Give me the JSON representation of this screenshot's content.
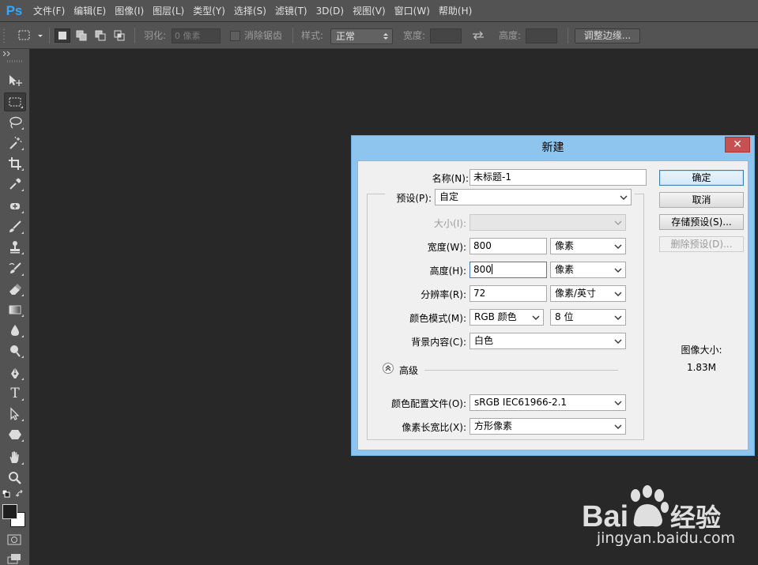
{
  "app": {
    "logo": "Ps"
  },
  "menu": [
    "文件(F)",
    "编辑(E)",
    "图像(I)",
    "图层(L)",
    "类型(Y)",
    "选择(S)",
    "滤镜(T)",
    "3D(D)",
    "视图(V)",
    "窗口(W)",
    "帮助(H)"
  ],
  "options": {
    "feather_label": "羽化:",
    "feather_value": "0 像素",
    "antialias_label": "消除锯齿",
    "style_label": "样式:",
    "style_value": "正常",
    "width_label": "宽度:",
    "height_label": "高度:",
    "refine_button": "调整边缘..."
  },
  "tools": [
    "move-tool-icon",
    "marquee-tool-icon",
    "lasso-tool-icon",
    "magic-wand-tool-icon",
    "crop-tool-icon",
    "eyedropper-tool-icon",
    "healing-brush-tool-icon",
    "brush-tool-icon",
    "clone-stamp-tool-icon",
    "history-brush-tool-icon",
    "eraser-tool-icon",
    "gradient-tool-icon",
    "blur-tool-icon",
    "dodge-tool-icon",
    "pen-tool-icon",
    "type-tool-icon",
    "path-selection-tool-icon",
    "shape-tool-icon",
    "hand-tool-icon",
    "zoom-tool-icon"
  ],
  "type_tool_glyph": "T",
  "dialog": {
    "title": "新建",
    "close_glyph": "✕",
    "name_label": "名称(N):",
    "name_value": "未标题-1",
    "preset_label": "预设(P):",
    "preset_value": "自定",
    "size_label": "大小(I):",
    "width_label": "宽度(W):",
    "width_value": "800",
    "width_unit": "像素",
    "height_label": "高度(H):",
    "height_value": "800",
    "height_unit": "像素",
    "resolution_label": "分辨率(R):",
    "resolution_value": "72",
    "resolution_unit": "像素/英寸",
    "color_mode_label": "颜色模式(M):",
    "color_mode_value": "RGB 颜色",
    "bit_depth_value": "8 位",
    "background_label": "背景内容(C):",
    "background_value": "白色",
    "advanced_label": "高级",
    "profile_label": "颜色配置文件(O):",
    "profile_value": "sRGB IEC61966-2.1",
    "aspect_label": "像素长宽比(X):",
    "aspect_value": "方形像素",
    "ok_button": "确定",
    "cancel_button": "取消",
    "save_preset_button": "存储预设(S)...",
    "delete_preset_button": "删除预设(D)...",
    "image_size_label": "图像大小:",
    "image_size_value": "1.83M"
  },
  "watermark": {
    "brand": "Baidu经验",
    "url": "jingyan.baidu.com"
  },
  "colors": {
    "accent": "#31a8ff",
    "dialog_frame": "#8ec5ef",
    "close_red": "#c75050",
    "workspace": "#282828"
  }
}
